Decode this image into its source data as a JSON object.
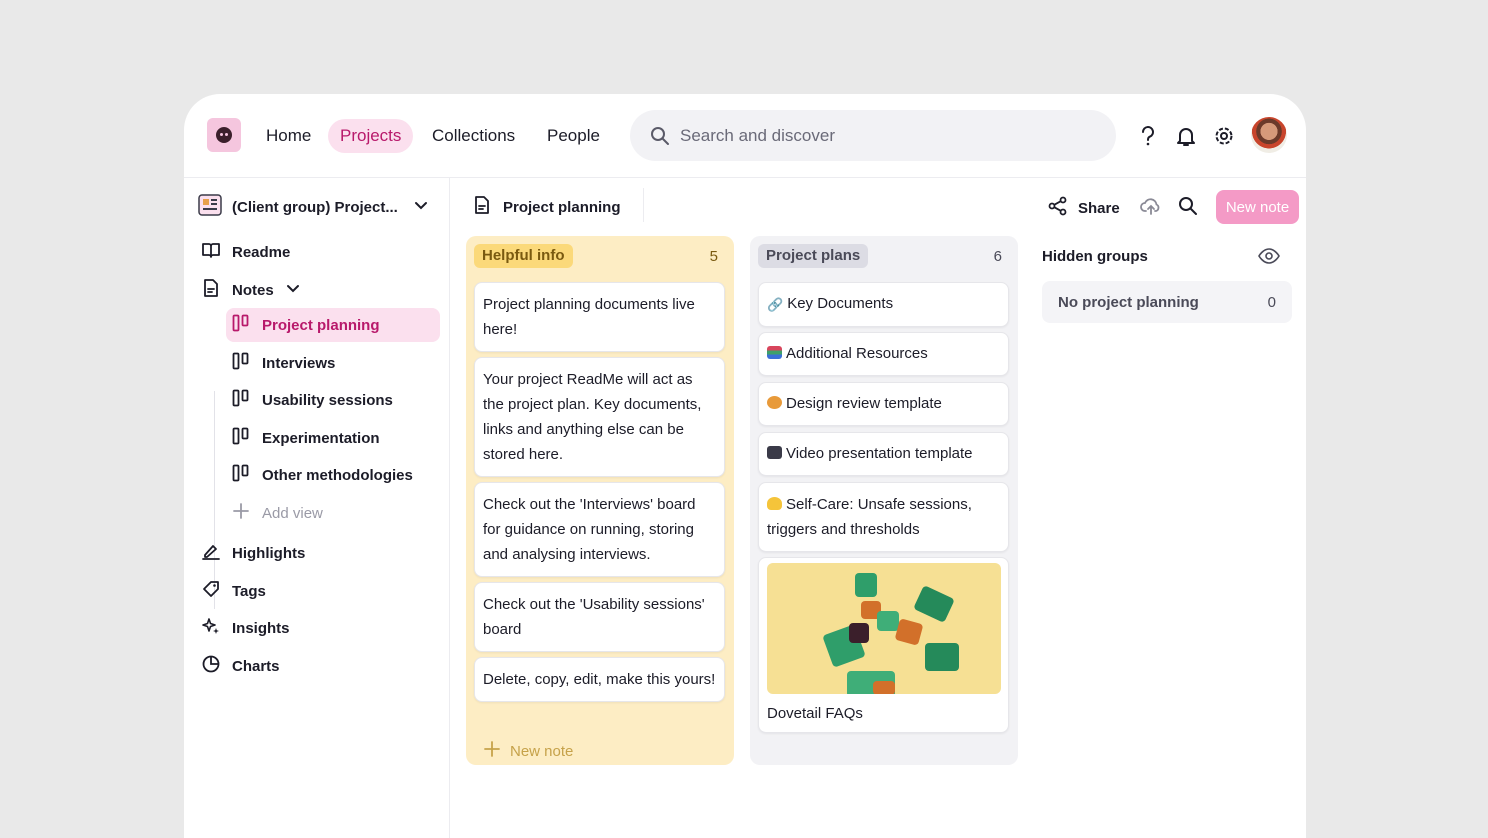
{
  "nav": {
    "home": "Home",
    "projects": "Projects",
    "collections": "Collections",
    "people": "People",
    "search_placeholder": "Search and discover"
  },
  "colors": {
    "accent": "#b8196b",
    "accent_bg": "#fbe0ee",
    "new_note_button": "#f49ac6",
    "helpful_info_column": "#fdedc4"
  },
  "sidebar": {
    "project_name": "(Client group) Project...",
    "readme": "Readme",
    "notes": "Notes",
    "views": [
      "Project planning",
      "Interviews",
      "Usability sessions",
      "Experimentation",
      "Other methodologies"
    ],
    "add_view": "Add view",
    "highlights": "Highlights",
    "tags": "Tags",
    "insights": "Insights",
    "charts": "Charts"
  },
  "board": {
    "title": "Project planning",
    "share": "Share",
    "new_note_button": "New note"
  },
  "columns": [
    {
      "name": "Helpful info",
      "count": "5",
      "cards": [
        "Project planning documents live here!",
        "Your project ReadMe will act as the project plan. Key documents, links and anything else can be stored here.",
        "Check out the 'Interviews' board for guidance on running, storing and analysing interviews.",
        "Check out the 'Usability sessions' board",
        "Delete, copy, edit, make this yours!"
      ],
      "add_note": "New note"
    },
    {
      "name": "Project plans",
      "count": "6",
      "cards": [
        "Key Documents",
        "Additional Resources",
        "Design review template",
        "Video presentation template",
        "Self-Care: Unsafe sessions, triggers and thresholds",
        "Dovetail FAQs"
      ]
    }
  ],
  "hidden_groups": {
    "title": "Hidden groups",
    "row_label": "No project planning",
    "row_count": "0"
  }
}
